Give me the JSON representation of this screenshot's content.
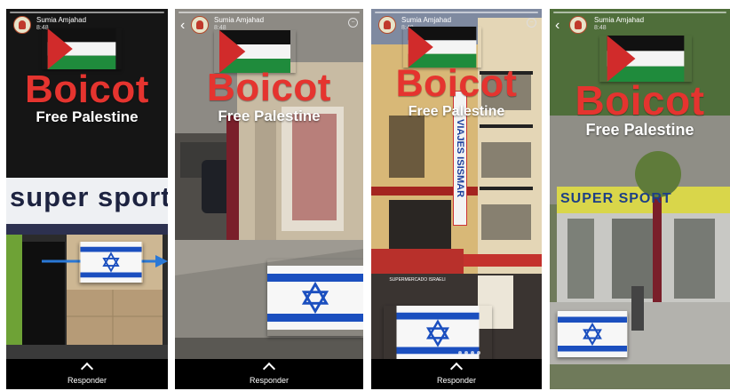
{
  "common": {
    "user_name": "Sumia Amjahad",
    "time": "8:48",
    "title": "Boicot",
    "subtitle": "Free Palestine",
    "reply_label": "Responder",
    "colors": {
      "title_red": "#e5342f",
      "flag_green": "#1f8b3c",
      "flag_red": "#d12b2b",
      "israel_blue": "#1b4fbf"
    }
  },
  "story1": {
    "shop_sign": "super sport",
    "icons": [
      "avatar-icon",
      "palestine-flag-icon",
      "israel-flag-icon",
      "arrow-icon",
      "chevron-up-icon"
    ]
  },
  "story2": {
    "icons": [
      "back-icon",
      "avatar-icon",
      "palestine-flag-icon",
      "israel-flag-icon",
      "more-icon",
      "chevron-up-icon"
    ]
  },
  "story3": {
    "vertical_sign": "VIAJES ISISMAR",
    "awning_sign": "SUPERMERCADO ISRAELI",
    "icons": [
      "avatar-icon",
      "palestine-flag-icon",
      "israel-flag-icon",
      "more-icon",
      "chevron-up-icon"
    ]
  },
  "story4": {
    "shop_sign": "SUPER SPORT",
    "icons": [
      "back-icon",
      "avatar-icon",
      "palestine-flag-icon",
      "israel-flag-icon",
      "chevron-up-icon"
    ]
  }
}
